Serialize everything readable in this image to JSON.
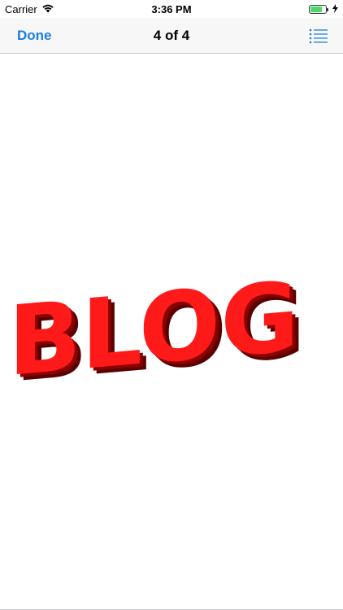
{
  "status_bar": {
    "carrier": "Carrier",
    "time": "3:36 PM",
    "battery_level": 0.8
  },
  "nav": {
    "done_label": "Done",
    "title": "4 of 4",
    "list_icon": "list-icon"
  },
  "content": {
    "image_text": "BLOG",
    "image_color": "#ff1a1a",
    "image_shadow_color": "#5a0000"
  },
  "colors": {
    "accent": "#1a7ee0",
    "nav_background": "#f7f7f7",
    "battery_green": "#4cd964"
  }
}
